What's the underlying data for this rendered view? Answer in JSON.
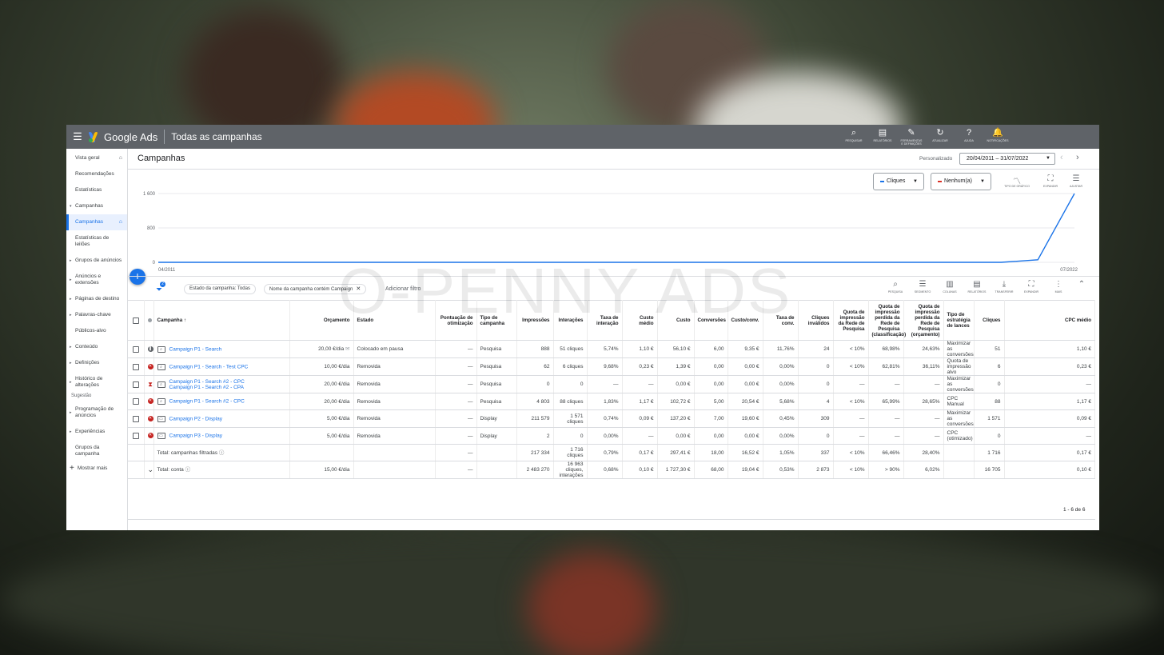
{
  "topbar": {
    "brand": "Google Ads",
    "title": "Todas as campanhas",
    "icons": [
      {
        "icon": "search-icon",
        "label": "PESQUISAR"
      },
      {
        "icon": "reports-icon",
        "label": "RELATÓRIOS"
      },
      {
        "icon": "tools-icon",
        "label": "FERRAMENTAS E DEFINIÇÕES"
      },
      {
        "icon": "refresh-icon",
        "label": "ATUALIZAR"
      },
      {
        "icon": "help-icon",
        "label": "AJUDA"
      },
      {
        "icon": "bell-icon",
        "label": "NOTIFICAÇÕES"
      }
    ]
  },
  "sidebar": {
    "items": [
      "Vista geral",
      "Recomendações",
      "Estatísticas",
      "Campanhas",
      "Campanhas",
      "Estatísticas de leilões",
      "Grupos de anúncios",
      "Anúncios e extensões",
      "Páginas de destino",
      "Palavras-chave",
      "Públicos-alvo",
      "Conteúdo",
      "Definições",
      "Histórico de alterações",
      "Sugestão",
      "Programação de anúncios",
      "Experiências",
      "Grupos da campanha",
      "Mostrar mais"
    ]
  },
  "page": {
    "title": "Campanhas",
    "range_label": "Personalizado",
    "date_range": "20/04/2011 – 31/07/2022"
  },
  "chart_controls": {
    "metric1": "Cliques",
    "metric2": "Nenhum(a)",
    "icons": [
      {
        "icon": "chart-type-icon",
        "label": "TIPO DE GRÁFICO"
      },
      {
        "icon": "expand-icon",
        "label": "EXPANDIR"
      },
      {
        "icon": "adjust-icon",
        "label": "AJUSTAR"
      }
    ],
    "colors": {
      "metric1": "#1a73e8",
      "metric2": "#d93025"
    }
  },
  "chart_data": {
    "type": "line",
    "x": [
      "04/2011",
      "07/2022"
    ],
    "ytick_labels": [
      "1 600",
      "800",
      "0"
    ],
    "series": [
      {
        "values": [
          0,
          0,
          0,
          0,
          0,
          0,
          0,
          0,
          0,
          0,
          0,
          0,
          0,
          0,
          0,
          0,
          0,
          0,
          0,
          0,
          0,
          0,
          0,
          0,
          60,
          1600
        ]
      }
    ],
    "ylim": [
      0,
      1600
    ],
    "grid": true
  },
  "filters": {
    "badge": "2",
    "chips": [
      "Estado da campanha: Todas",
      "Nome da campanha contém Campaign"
    ],
    "add": "Adicionar filtro",
    "tools": [
      {
        "icon": "search-icon",
        "label": "PESQUISA"
      },
      {
        "icon": "segment-icon",
        "label": "SEGMENTO"
      },
      {
        "icon": "columns-icon",
        "label": "COLUNAS"
      },
      {
        "icon": "reports-icon",
        "label": "RELATÓRIOS"
      },
      {
        "icon": "download-icon",
        "label": "TRANSFERIR"
      },
      {
        "icon": "expand-icon",
        "label": "EXPANDIR"
      },
      {
        "icon": "more-icon",
        "label": "MAIS"
      }
    ]
  },
  "table": {
    "headers": [
      "Campanha ↑",
      "Orçamento",
      "Estado",
      "Pontuação de otimização",
      "Tipo de campanha",
      "Impressões",
      "Interações",
      "Taxa de interação",
      "Custo médio",
      "Custo",
      "Conversões",
      "Custo/conv.",
      "Taxa de conv.",
      "Cliques inválidos",
      "Quota de impressão da Rede de Pesquisa",
      "Quota de impressão perdida da Rede de Pesquisa (classificação)",
      "Quota de impressão perdida da Rede de Pesquisa (orçamento)",
      "Tipo de estratégia de lances",
      "Cliques",
      "CPC médio"
    ],
    "rows": [
      {
        "name": "Campaign P1 - Search",
        "budget": "20,00 €/dia",
        "status": "Colocado em pausa",
        "score": "—",
        "type": "Pesquisa",
        "impr": "888",
        "inter": "51 cliques",
        "ir": "5,74%",
        "avg": "1,10 €",
        "cost": "56,10 €",
        "conv": "6,00",
        "cpc": "9,35 €",
        "cr": "11,76%",
        "inv": "24",
        "is": "< 10%",
        "isr": "68,98%",
        "isb": "24,63%",
        "bid": "Maximizar as conversões",
        "clicks": "51",
        "avgcpc": "1,10 €"
      },
      {
        "name": "Campaign P1 - Search - Test CPC",
        "budget": "10,00 €/dia",
        "status": "Removida",
        "score": "—",
        "type": "Pesquisa",
        "impr": "62",
        "inter": "6 cliques",
        "ir": "9,68%",
        "avg": "0,23 €",
        "cost": "1,39 €",
        "conv": "0,00",
        "cpc": "0,00 €",
        "cr": "0,00%",
        "inv": "0",
        "is": "< 10%",
        "isr": "62,81%",
        "isb": "36,11%",
        "bid": "Quota de impressão alvo",
        "clicks": "6",
        "avgcpc": "0,23 €"
      },
      {
        "name": "Campaign P1 - Search #2 - CPC",
        "name2": "Campaign P1 - Search #2 - CPA",
        "budget": "20,00 €/dia",
        "status": "Removida",
        "score": "—",
        "type": "Pesquisa",
        "impr": "0",
        "inter": "0",
        "ir": "—",
        "avg": "—",
        "cost": "0,00 €",
        "conv": "0,00",
        "cpc": "0,00 €",
        "cr": "0,00%",
        "inv": "0",
        "is": "—",
        "isr": "—",
        "isb": "—",
        "bid": "Maximizar as conversões",
        "clicks": "0",
        "avgcpc": "—"
      },
      {
        "name": "Campaign P1 - Search #2 - CPC",
        "budget": "20,00 €/dia",
        "status": "Removida",
        "score": "—",
        "type": "Pesquisa",
        "impr": "4 803",
        "inter": "88 cliques",
        "ir": "1,83%",
        "avg": "1,17 €",
        "cost": "102,72 €",
        "conv": "5,00",
        "cpc": "20,54 €",
        "cr": "5,68%",
        "inv": "4",
        "is": "< 10%",
        "isr": "65,99%",
        "isb": "28,65%",
        "bid": "CPC Manual",
        "clicks": "88",
        "avgcpc": "1,17 €"
      },
      {
        "name": "Campaign P2 - Display",
        "budget": "5,00 €/dia",
        "status": "Removida",
        "score": "—",
        "type": "Display",
        "impr": "211 579",
        "inter": "1 571 cliques",
        "ir": "0,74%",
        "avg": "0,09 €",
        "cost": "137,20 €",
        "conv": "7,00",
        "cpc": "19,60 €",
        "cr": "0,45%",
        "inv": "309",
        "is": "—",
        "isr": "—",
        "isb": "—",
        "bid": "Maximizar as conversões",
        "clicks": "1 571",
        "avgcpc": "0,09 €"
      },
      {
        "name": "Campaign P3 - Display",
        "budget": "5,00 €/dia",
        "status": "Removida",
        "score": "—",
        "type": "Display",
        "impr": "2",
        "inter": "0",
        "ir": "0,00%",
        "avg": "—",
        "cost": "0,00 €",
        "conv": "0,00",
        "cpc": "0,00 €",
        "cr": "0,00%",
        "inv": "0",
        "is": "—",
        "isr": "—",
        "isb": "—",
        "bid": "CPC (otimizado)",
        "clicks": "0",
        "avgcpc": "—"
      }
    ],
    "totals": [
      {
        "label": "Total: campanhas filtradas",
        "budget": "",
        "score": "—",
        "impr": "217 334",
        "inter": "1 716 cliques",
        "ir": "0,79%",
        "avg": "0,17 €",
        "cost": "297,41 €",
        "conv": "18,00",
        "cpc": "16,52 €",
        "cr": "1,05%",
        "inv": "337",
        "is": "< 10%",
        "isr": "66,46%",
        "isb": "28,40%",
        "clicks": "1 716",
        "avgcpc": "0,17 €"
      },
      {
        "label": "Total: conta",
        "budget": "15,00 €/dia",
        "score": "—",
        "impr": "2 483 270",
        "inter": "16 963 cliques, interações",
        "ir": "0,68%",
        "avg": "0,10 €",
        "cost": "1 727,30 €",
        "conv": "68,00",
        "cpc": "19,04 €",
        "cr": "0,53%",
        "inv": "2 873",
        "is": "< 10%",
        "isr": "> 90%",
        "isb": "6,02%",
        "clicks": "16 705",
        "avgcpc": "0,10 €"
      }
    ],
    "pager": "1 - 6 de 6"
  },
  "watermark": "O-PENNY ADS"
}
